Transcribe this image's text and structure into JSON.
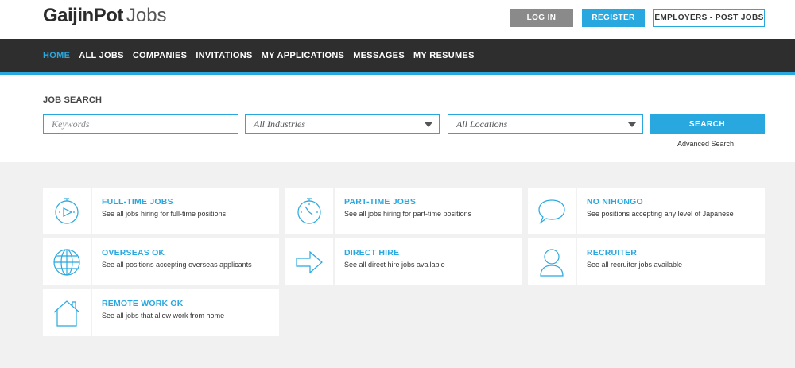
{
  "header": {
    "logo_main": "GaijinPot",
    "logo_sub": "Jobs",
    "login_label": "LOG IN",
    "register_label": "REGISTER",
    "employers_label": "EMPLOYERS - POST JOBS"
  },
  "nav": {
    "items": [
      {
        "label": "HOME",
        "active": true
      },
      {
        "label": "ALL JOBS"
      },
      {
        "label": "COMPANIES"
      },
      {
        "label": "INVITATIONS"
      },
      {
        "label": "MY APPLICATIONS"
      },
      {
        "label": "MESSAGES"
      },
      {
        "label": "MY RESUMES"
      }
    ]
  },
  "search": {
    "title": "JOB SEARCH",
    "keywords_placeholder": "Keywords",
    "industries_value": "All Industries",
    "locations_value": "All Locations",
    "button_label": "SEARCH",
    "advanced_label": "Advanced Search"
  },
  "categories": [
    {
      "title": "FULL-TIME JOBS",
      "desc": "See all jobs hiring for full-time positions",
      "icon": "stopwatch-play-icon"
    },
    {
      "title": "PART-TIME JOBS",
      "desc": "See all jobs hiring for part-time positions",
      "icon": "stopwatch-icon"
    },
    {
      "title": "NO NIHONGO",
      "desc": "See positions accepting any level of Japanese",
      "icon": "speech-bubble-icon"
    },
    {
      "title": "OVERSEAS OK",
      "desc": "See all positions accepting overseas applicants",
      "icon": "globe-icon"
    },
    {
      "title": "DIRECT HIRE",
      "desc": "See all direct hire jobs available",
      "icon": "arrow-right-icon"
    },
    {
      "title": "RECRUITER",
      "desc": "See all recruiter jobs available",
      "icon": "person-icon"
    },
    {
      "title": "REMOTE WORK OK",
      "desc": "See all jobs that allow work from home",
      "icon": "house-icon"
    }
  ],
  "colors": {
    "accent": "#29a8e0",
    "nav_bg": "#2e2e2e",
    "login_bg": "#8a8a8a",
    "page_bg": "#f1f1f1"
  }
}
